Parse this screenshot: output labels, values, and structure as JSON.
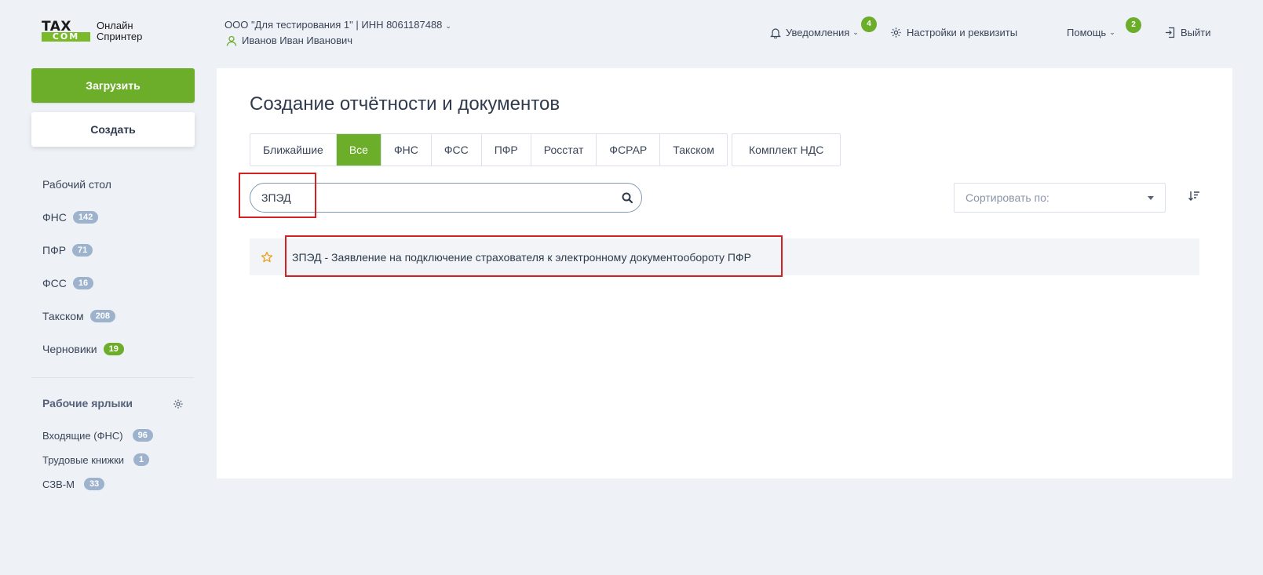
{
  "header": {
    "logo_top": "TAX",
    "logo_bottom": "COM",
    "logo_line1": "Онлайн",
    "logo_line2": "Спринтер",
    "organization": "ООО \"Для тестирования 1\" | ИНН 8061187488",
    "user_name": "Иванов Иван Иванович",
    "notifications_label": "Уведомления",
    "notifications_count": "4",
    "settings_label": "Настройки и реквизиты",
    "help_label": "Помощь",
    "help_count": "2",
    "logout_label": "Выйти"
  },
  "sidebar": {
    "upload_label": "Загрузить",
    "create_label": "Создать",
    "items": [
      {
        "label": "Рабочий стол",
        "count": ""
      },
      {
        "label": "ФНС",
        "count": "142"
      },
      {
        "label": "ПФР",
        "count": "71"
      },
      {
        "label": "ФСС",
        "count": "16"
      },
      {
        "label": "Такском",
        "count": "208"
      },
      {
        "label": "Черновики",
        "count": "19"
      }
    ],
    "shortcuts_title": "Рабочие ярлыки",
    "shortcuts": [
      {
        "label": "Входящие (ФНС)",
        "count": "96"
      },
      {
        "label": "Трудовые книжки",
        "count": "1"
      },
      {
        "label": "СЗВ-М",
        "count": "33"
      }
    ]
  },
  "main": {
    "title": "Создание отчётности и документов",
    "tabs": [
      {
        "label": "Ближайшие"
      },
      {
        "label": "Все"
      },
      {
        "label": "ФНС"
      },
      {
        "label": "ФСС"
      },
      {
        "label": "ПФР"
      },
      {
        "label": "Росстат"
      },
      {
        "label": "ФСРАР"
      },
      {
        "label": "Такском"
      }
    ],
    "active_tab": "Все",
    "nds_tab": "Комплект НДС",
    "search_value": "ЗПЭД",
    "sort_placeholder": "Сортировать по:",
    "results": [
      {
        "label": "ЗПЭД - Заявление на подключение страхователя к электронному документообороту ПФР"
      }
    ]
  },
  "colors": {
    "accent": "#6cae2a",
    "highlight": "#d42020"
  }
}
